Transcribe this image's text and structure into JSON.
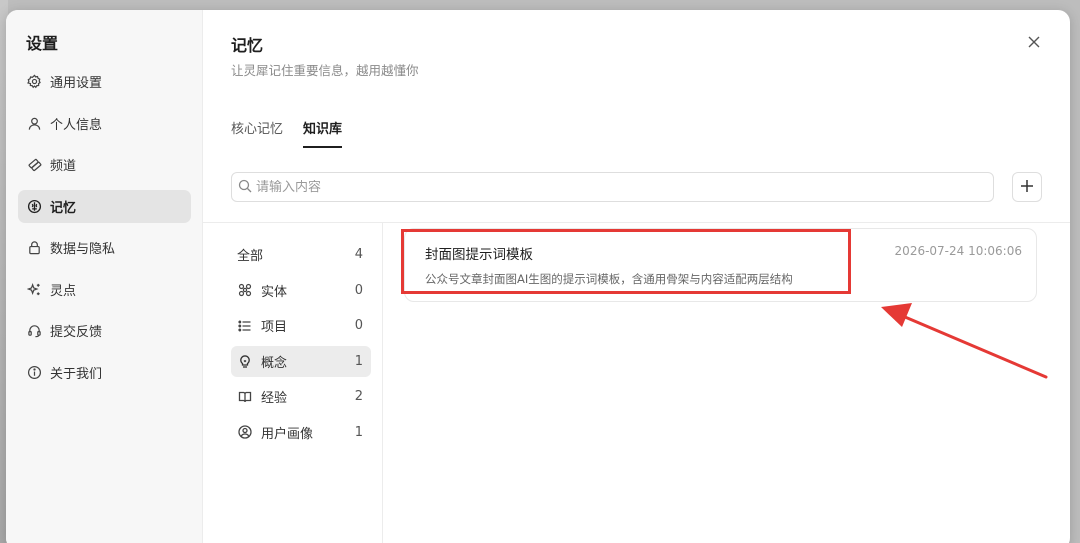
{
  "sidebar": {
    "title": "设置",
    "items": [
      {
        "label": "通用设置",
        "icon": "gear-icon"
      },
      {
        "label": "个人信息",
        "icon": "user-icon"
      },
      {
        "label": "频道",
        "icon": "channel-icon"
      },
      {
        "label": "记忆",
        "icon": "memory-icon",
        "active": true
      },
      {
        "label": "数据与隐私",
        "icon": "lock-icon"
      },
      {
        "label": "灵点",
        "icon": "sparkle-icon"
      },
      {
        "label": "提交反馈",
        "icon": "headset-icon"
      },
      {
        "label": "关于我们",
        "icon": "info-icon"
      }
    ]
  },
  "main": {
    "title": "记忆",
    "subtitle": "让灵犀记住重要信息，越用越懂你",
    "tabs": [
      {
        "label": "核心记忆"
      },
      {
        "label": "知识库",
        "active": true
      }
    ],
    "search": {
      "placeholder": "请输入内容",
      "value": ""
    },
    "categories": [
      {
        "label": "全部",
        "count": "4",
        "icon": ""
      },
      {
        "label": "实体",
        "count": "0",
        "icon": "entity-icon"
      },
      {
        "label": "项目",
        "count": "0",
        "icon": "list-icon"
      },
      {
        "label": "概念",
        "count": "1",
        "icon": "bulb-icon",
        "active": true
      },
      {
        "label": "经验",
        "count": "2",
        "icon": "book-icon"
      },
      {
        "label": "用户画像",
        "count": "1",
        "icon": "user-circle-icon"
      }
    ],
    "cards": [
      {
        "title": "封面图提示词模板",
        "description": "公众号文章封面图AI生图的提示词模板，含通用骨架与内容适配两层结构",
        "timestamp": "2026-07-24 10:06:06"
      }
    ]
  },
  "colors": {
    "annotation": "#e53935",
    "active_bg": "#e4e4e4",
    "sidebar_bg": "#f7f7f7"
  }
}
